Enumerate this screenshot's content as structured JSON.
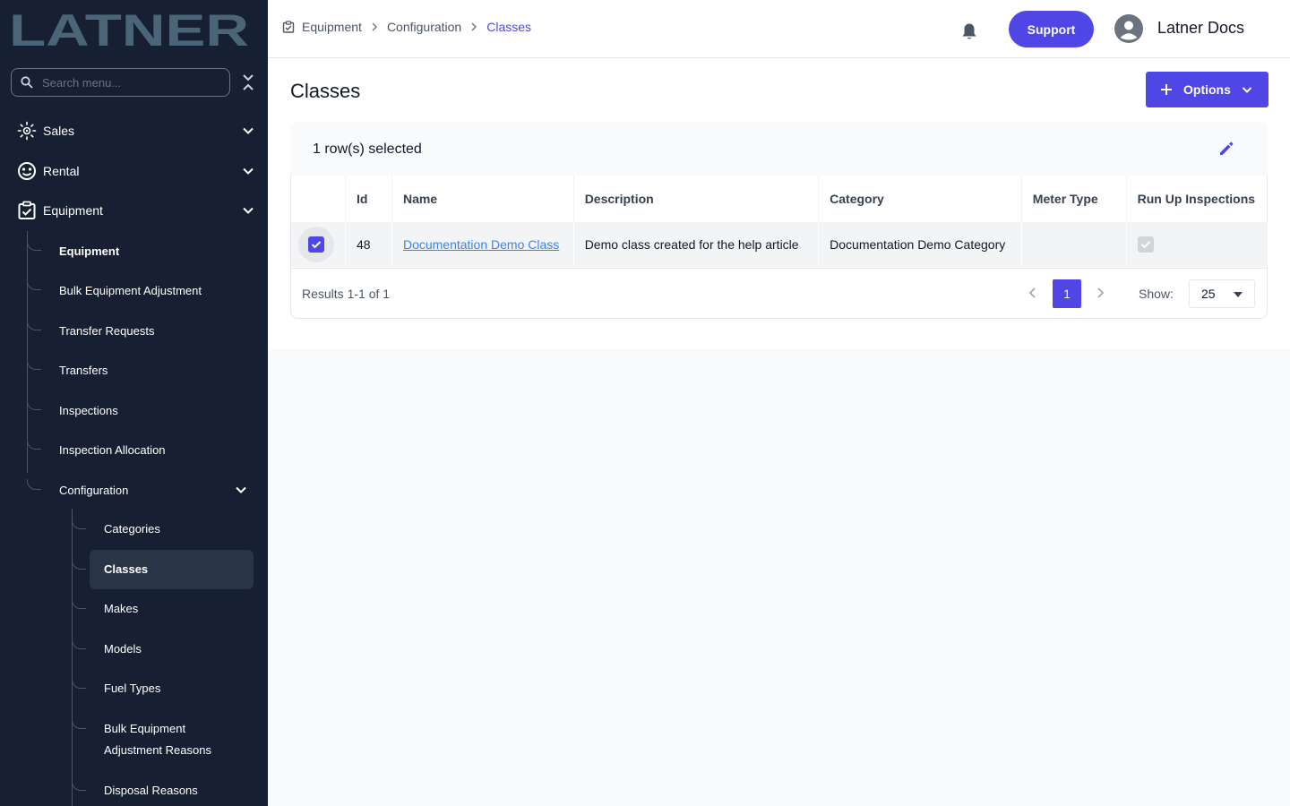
{
  "brand": {
    "logo_text": "LATNER",
    "accent": "#4f46e5",
    "sidebar_bg": "#172032"
  },
  "sidebar": {
    "search_placeholder": "Search menu...",
    "top_items": [
      {
        "label": "Sales",
        "icon": "sales-icon"
      },
      {
        "label": "Rental",
        "icon": "rental-icon"
      },
      {
        "label": "Equipment",
        "icon": "equipment-icon"
      }
    ],
    "equipment_items": [
      {
        "label": "Equipment"
      },
      {
        "label": "Bulk Equipment Adjustment"
      },
      {
        "label": "Transfer Requests"
      },
      {
        "label": "Transfers"
      },
      {
        "label": "Inspections"
      },
      {
        "label": "Inspection Allocation"
      },
      {
        "label": "Configuration"
      }
    ],
    "configuration_items": [
      {
        "label": "Categories"
      },
      {
        "label": "Classes"
      },
      {
        "label": "Makes"
      },
      {
        "label": "Models"
      },
      {
        "label": "Fuel Types"
      },
      {
        "label": "Bulk Equipment Adjustment Reasons"
      },
      {
        "label": "Disposal Reasons"
      }
    ],
    "active_item": "Classes"
  },
  "header": {
    "breadcrumbs": [
      "Equipment",
      "Configuration",
      "Classes"
    ],
    "support_label": "Support",
    "user_name": "Latner Docs"
  },
  "page": {
    "title": "Classes",
    "options_label": "Options",
    "selection_text": "1 row(s) selected"
  },
  "table": {
    "columns": [
      "Id",
      "Name",
      "Description",
      "Category",
      "Meter Type",
      "Run Up Inspections"
    ],
    "rows": [
      {
        "selected": true,
        "id": "48",
        "name": "Documentation Demo Class",
        "description": "Demo class created for the help article",
        "category": "Documentation Demo Category",
        "meter_type": "",
        "run_up_inspections": true
      }
    ]
  },
  "pagination": {
    "results_text": "Results 1-1 of 1",
    "current_page": "1",
    "show_label": "Show:",
    "page_size": "25"
  }
}
